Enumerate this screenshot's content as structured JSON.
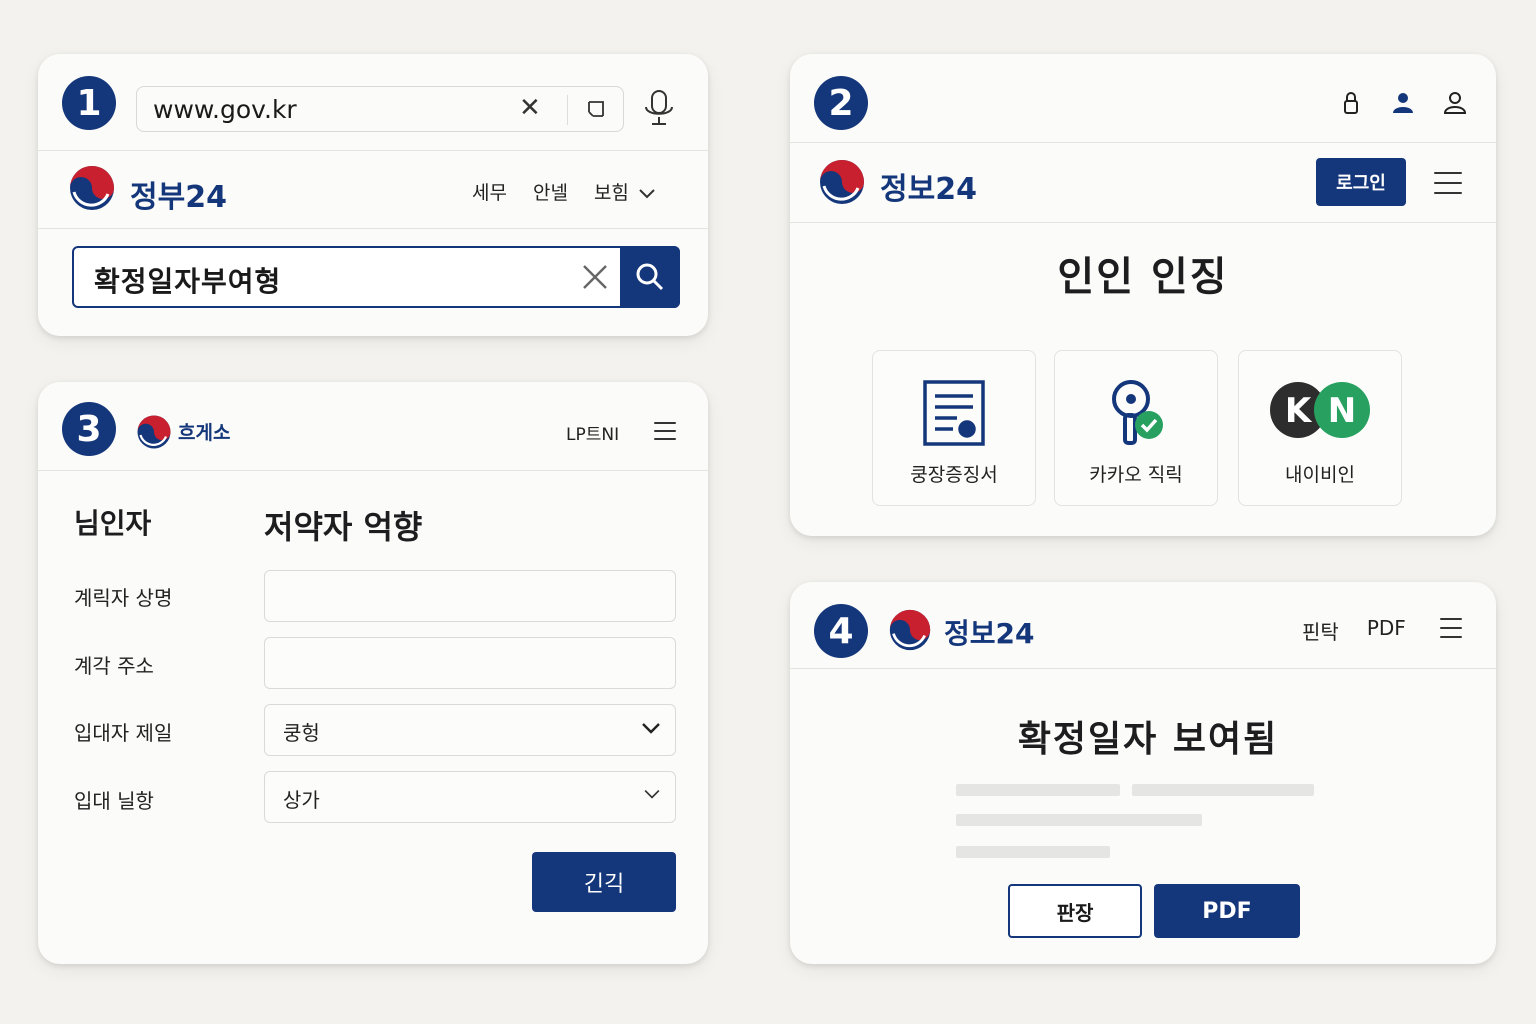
{
  "colors": {
    "brand": "#14367a",
    "background": "#f3f2ee",
    "card": "#fbfbf9"
  },
  "panel1": {
    "step": "1",
    "browser": {
      "url": "www.gov.kr"
    },
    "brand": "정부24",
    "nav": [
      "세무",
      "안넬",
      "보힘"
    ],
    "search": {
      "query": "확정일자부여형"
    }
  },
  "panel2": {
    "step": "2",
    "brand": "정보24",
    "login_label": "로그인",
    "title": "인인 인징",
    "options": [
      {
        "label": "쿵장증징서",
        "icon": "certificate-icon"
      },
      {
        "label": "카카오 직릭",
        "icon": "kakao-key-icon"
      },
      {
        "label": "내이비인",
        "icon": "kn-logo-icon"
      }
    ]
  },
  "panel3": {
    "step": "3",
    "brand": "흐게소",
    "menu_label": "LP트NI",
    "section_left": "님인자",
    "section_right": "저약자 억향",
    "fields": [
      {
        "label": "계릭자 상명",
        "value": ""
      },
      {
        "label": "계각 주소",
        "value": ""
      },
      {
        "label": "입대자 제일",
        "value": "쿵헝"
      },
      {
        "label": "입대 닐항",
        "value": "상가"
      }
    ],
    "submit_label": "긴긱"
  },
  "panel4": {
    "step": "4",
    "brand": "정보24",
    "nav": [
      "핀탁",
      "PDF"
    ],
    "title": "확정일자 보여됨",
    "outline_button": "판장",
    "pdf_button": "PDF"
  }
}
